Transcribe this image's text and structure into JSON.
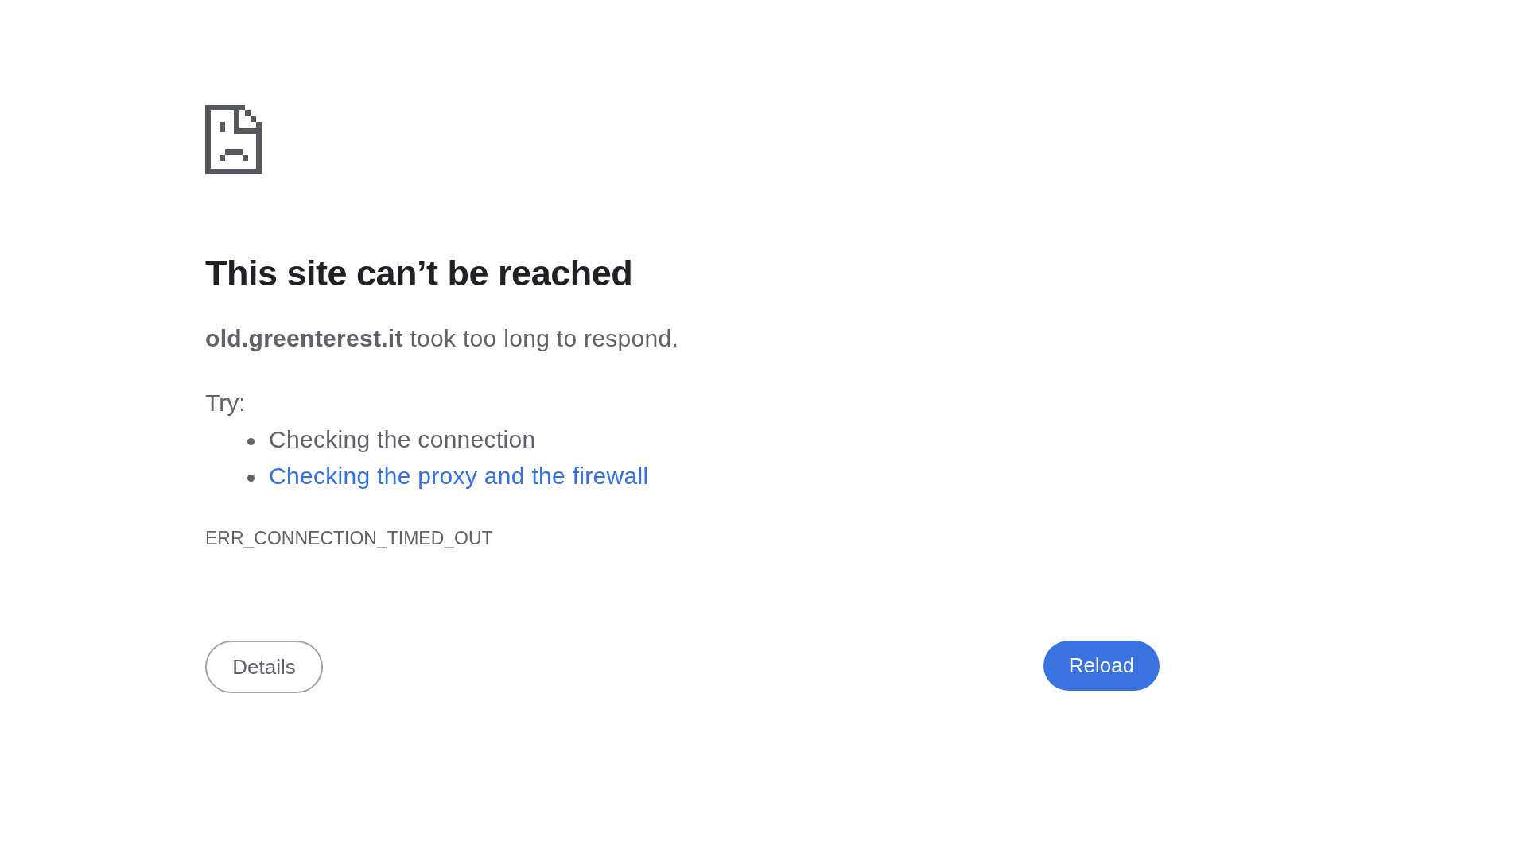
{
  "heading": "This site can’t be reached",
  "message": "**old.greenterest.it** took too long to respond.",
  "suggestions": {
    "label": "Try:",
    "items": [
      {
        "kind": "text",
        "text": "Checking the connection"
      },
      {
        "kind": "link",
        "text": "Checking the proxy and the firewall"
      }
    ]
  },
  "error_code": "ERR_CONNECTION_TIMED_OUT",
  "buttons": [
    {
      "kind": "secondary",
      "label": "Details"
    },
    {
      "kind": "primary",
      "label": "Reload"
    }
  ]
}
